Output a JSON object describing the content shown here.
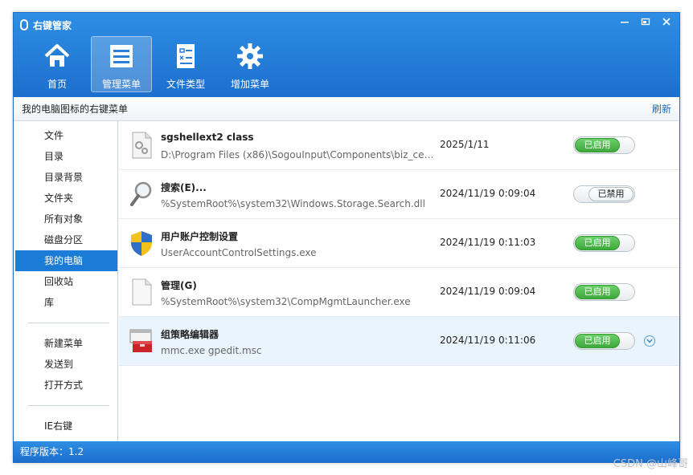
{
  "window": {
    "title": "右键管家",
    "controls": [
      "restore",
      "maximize",
      "close"
    ]
  },
  "nav": [
    {
      "label": "首页",
      "icon": "home-icon"
    },
    {
      "label": "管理菜单",
      "icon": "menu-list-icon",
      "active": true
    },
    {
      "label": "文件类型",
      "icon": "file-type-icon"
    },
    {
      "label": "增加菜单",
      "icon": "gear-icon"
    }
  ],
  "subheader": {
    "title": "我的电脑图标的右键菜单",
    "refresh": "刷新"
  },
  "sidebar": {
    "group1": [
      "文件",
      "目录",
      "目录背景",
      "文件夹",
      "所有对象",
      "磁盘分区",
      "我的电脑",
      "回收站",
      "库"
    ],
    "active": "我的电脑",
    "group2": [
      "新建菜单",
      "发送到",
      "打开方式"
    ],
    "group3": [
      "IE右键"
    ]
  },
  "rows": [
    {
      "name": "sgshellext2 class",
      "path": "D:\\Program Files (x86)\\SogouInput\\Components\\biz_cent...",
      "time": "2025/1/11",
      "state": "已启用",
      "on": true,
      "icon": "gear-document-icon"
    },
    {
      "name": "搜索(E)...",
      "path": "%SystemRoot%\\system32\\Windows.Storage.Search.dll",
      "time": "2024/11/19 0:09:04",
      "state": "已禁用",
      "on": false,
      "icon": "magnifier-icon"
    },
    {
      "name": "用户账户控制设置",
      "path": "UserAccountControlSettings.exe",
      "time": "2024/11/19 0:11:03",
      "state": "已启用",
      "on": true,
      "icon": "uac-shield-icon"
    },
    {
      "name": "管理(G)",
      "path": "%SystemRoot%\\system32\\CompMgmtLauncher.exe",
      "time": "2024/11/19 0:09:04",
      "state": "已启用",
      "on": true,
      "icon": "blank-document-icon"
    },
    {
      "name": "组策略编辑器",
      "path": "mmc.exe gpedit.msc",
      "time": "2024/11/19 0:11:06",
      "state": "已启用",
      "on": true,
      "icon": "toolbox-icon",
      "selected": true
    }
  ],
  "status": {
    "version": "程序版本：1.2"
  },
  "watermark": "CSDN @山峰哥",
  "colors": {
    "accent": "#1c6fcd",
    "toggle_on": "#3ea83b",
    "selected_row": "#eaf4fc"
  }
}
